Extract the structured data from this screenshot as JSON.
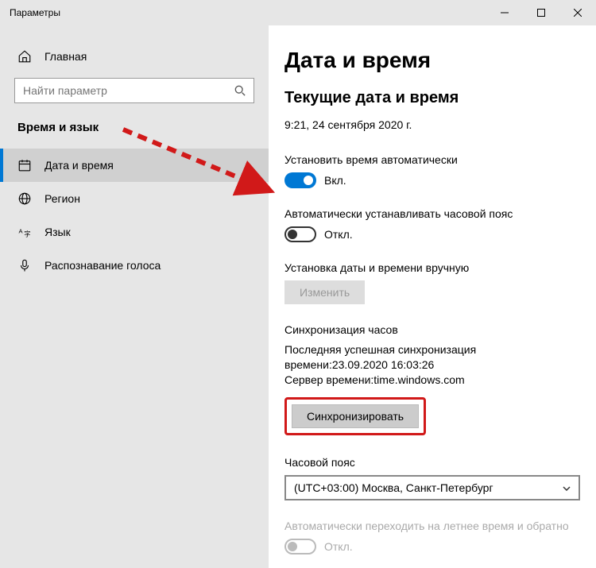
{
  "window": {
    "title": "Параметры"
  },
  "sidebar": {
    "home_label": "Главная",
    "search_placeholder": "Найти параметр",
    "section_heading": "Время и язык",
    "items": [
      {
        "label": "Дата и время",
        "active": true
      },
      {
        "label": "Регион",
        "active": false
      },
      {
        "label": "Язык",
        "active": false
      },
      {
        "label": "Распознавание голоса",
        "active": false
      }
    ]
  },
  "content": {
    "page_title": "Дата и время",
    "sub_heading": "Текущие дата и время",
    "current_datetime": "9:21, 24 сентября 2020 г.",
    "auto_time": {
      "label": "Установить время автоматически",
      "state_text": "Вкл."
    },
    "auto_tz": {
      "label": "Автоматически устанавливать часовой пояс",
      "state_text": "Откл."
    },
    "manual_set": {
      "label": "Установка даты и времени вручную",
      "button": "Изменить"
    },
    "sync": {
      "heading": "Синхронизация часов",
      "status_line1": "Последняя успешная синхронизация времени:23.09.2020 16:03:26",
      "status_line2": "Сервер времени:time.windows.com",
      "button": "Синхронизировать"
    },
    "tz": {
      "heading": "Часовой пояс",
      "value": "(UTC+03:00) Москва, Санкт-Петербург"
    },
    "dst": {
      "label": "Автоматически переходить на летнее время и обратно",
      "state_text": "Откл."
    }
  }
}
